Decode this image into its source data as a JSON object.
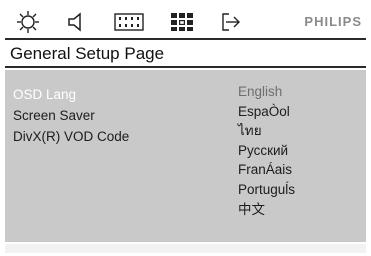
{
  "toolbar": {
    "icons": [
      "gear-settings-icon",
      "speaker-audio-icon",
      "filmstrip-video-icon",
      "grid-preference-icon",
      "exit-arrow-icon"
    ],
    "brand": "PHILIPS"
  },
  "page": {
    "title": "General Setup Page"
  },
  "menu": {
    "items": [
      {
        "label": "OSD Lang",
        "selected": true
      },
      {
        "label": "Screen Saver",
        "selected": false
      },
      {
        "label": "DivX(R) VOD Code",
        "selected": false
      }
    ]
  },
  "options": [
    {
      "label": "English",
      "current": true
    },
    {
      "label": "EspaÒol",
      "current": false
    },
    {
      "label": "ไทย",
      "current": false
    },
    {
      "label": "Русский",
      "current": false
    },
    {
      "label": "FranÁais",
      "current": false
    },
    {
      "label": "Portuguĺs",
      "current": false
    },
    {
      "label": "中文",
      "current": false
    }
  ],
  "colors": {
    "panel": "#c9c9c9",
    "divider": "#2a2a2a",
    "selected_text": "#ffffff",
    "brand": "#8a8a8a"
  }
}
